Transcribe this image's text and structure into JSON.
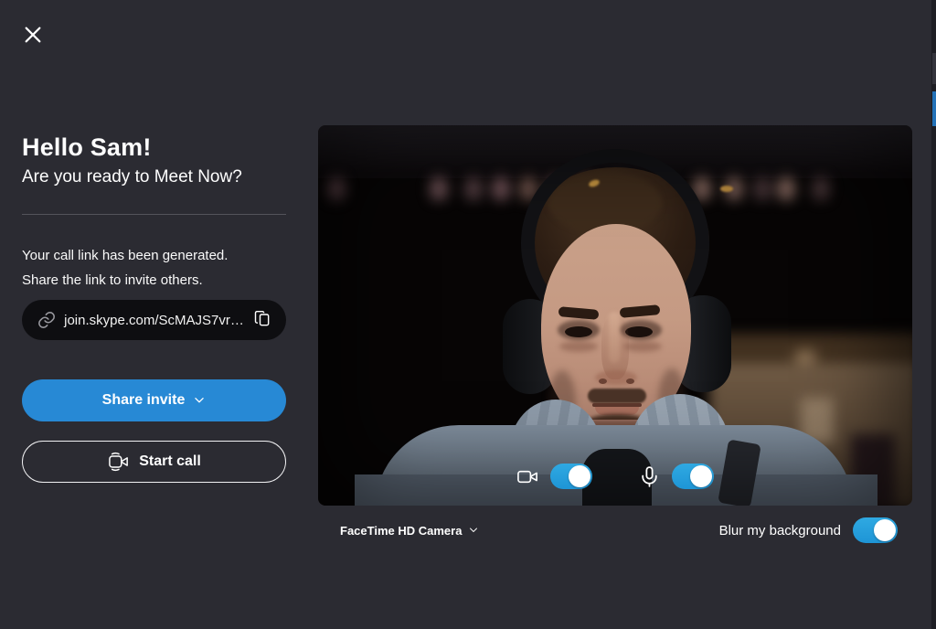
{
  "window": {
    "background": "#2b2b32"
  },
  "panel": {
    "title": "Hello Sam!",
    "subtitle": "Are you ready to Meet Now?",
    "info": [
      "Your call link has been generated.",
      "Share the link to invite others."
    ],
    "call_link": "join.skype.com/ScMAJS7vr…",
    "share_invite_label": "Share invite",
    "start_call_label": "Start call"
  },
  "preview": {
    "camera_on": true,
    "mic_on": true
  },
  "footer": {
    "camera_device": "FaceTime HD Camera",
    "blur_label": "Blur my background",
    "blur_on": true
  },
  "icons": {
    "close": "close-icon",
    "link": "chain-link-icon",
    "copy": "copy-icon",
    "chevron": "chevron-down-icon",
    "video": "video-camera-icon",
    "mic": "microphone-icon"
  },
  "colors": {
    "accent_blue": "#2789d5",
    "toggle_blue": "#24a0dc",
    "link_pill": "#0e0e11"
  }
}
